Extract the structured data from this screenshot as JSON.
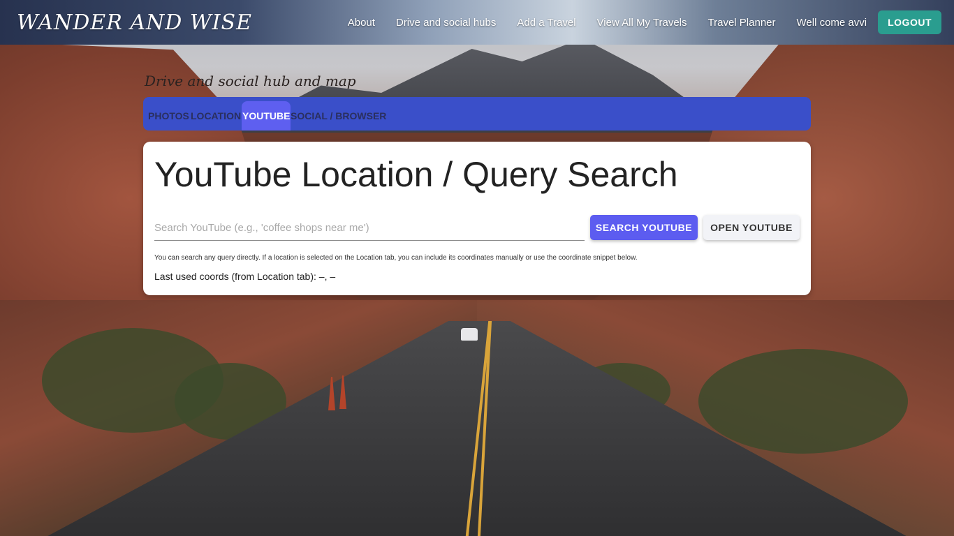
{
  "navbar": {
    "brand": "WANDER AND WISE",
    "links": [
      {
        "label": "About"
      },
      {
        "label": "Drive and social hubs"
      },
      {
        "label": "Add a Travel"
      },
      {
        "label": "View All My Travels"
      },
      {
        "label": "Travel Planner"
      },
      {
        "label": "Well come avvi"
      }
    ],
    "logout_label": "LOGOUT",
    "logout_color": "#2a9d8f"
  },
  "hub": {
    "title": "Drive and social hub and map",
    "tabs": [
      {
        "label": "PHOTOS",
        "active": false
      },
      {
        "label": "LOCATION",
        "active": false
      },
      {
        "label": "YOUTUBE",
        "active": true
      },
      {
        "label": "SOCIAL / BROWSER",
        "active": false
      }
    ],
    "tab_bar_color": "#3a4fc9",
    "active_tab_color": "#5e5ff0"
  },
  "youtube": {
    "heading": "YouTube Location / Query Search",
    "search_placeholder": "Search YouTube (e.g., 'coffee shops near me')",
    "search_value": "",
    "search_button": "SEARCH YOUTUBE",
    "open_button": "OPEN YOUTUBE",
    "help_text": "You can search any query directly. If a location is selected on the Location tab, you can include its coordinates manually or use the coordinate snippet below.",
    "coords_label": "Last used coords (from Location tab): –, –"
  },
  "colors": {
    "accent": "#5c5cf0"
  }
}
